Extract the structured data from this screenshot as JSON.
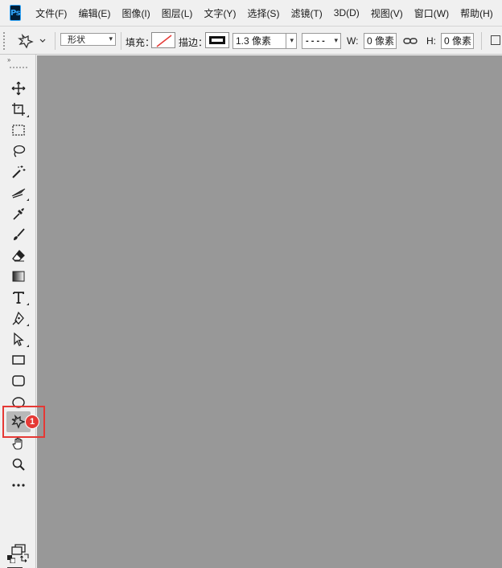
{
  "app": {
    "logo": "Ps"
  },
  "menu": [
    {
      "label": "文件(F)"
    },
    {
      "label": "编辑(E)"
    },
    {
      "label": "图像(I)"
    },
    {
      "label": "图层(L)"
    },
    {
      "label": "文字(Y)"
    },
    {
      "label": "选择(S)"
    },
    {
      "label": "滤镜(T)"
    },
    {
      "label": "3D(D)"
    },
    {
      "label": "视图(V)"
    },
    {
      "label": "窗口(W)"
    },
    {
      "label": "帮助(H)"
    }
  ],
  "options": {
    "mode_value": "形状",
    "fill_label": "填充：",
    "stroke_label": "描边：",
    "stroke_width_value": "1.3 像素",
    "stroke_style_value": "- - - -",
    "w_label": "W:",
    "w_value": "0 像素",
    "h_label": "H:",
    "h_value": "0 像素"
  },
  "toolbar": {
    "collapse": "››",
    "active_tool": "custom-shape-tool",
    "annotation_badge": "1",
    "foreground_color": "#4dd0e1",
    "background_color": "#c8c8cc"
  },
  "colors": {
    "canvas": "#989898",
    "highlight": "#e53935"
  }
}
